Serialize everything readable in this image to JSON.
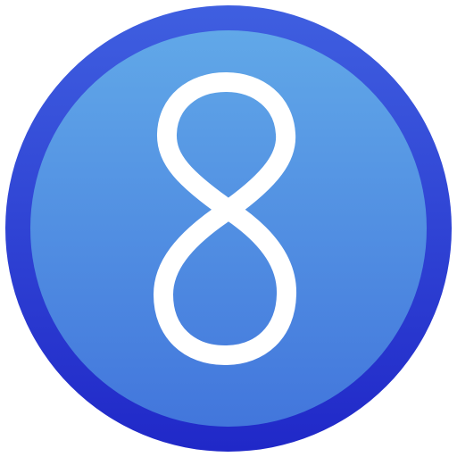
{
  "badge": {
    "digit": "8",
    "icon": "number-eight-badge-icon",
    "colors": {
      "outer_ring_top": "#3f5fe0",
      "outer_ring_bottom": "#2028c8",
      "inner_disc_top": "#61a8e8",
      "inner_disc_bottom": "#4276dc",
      "digit": "#ffffff",
      "background": "#ffffff"
    }
  }
}
